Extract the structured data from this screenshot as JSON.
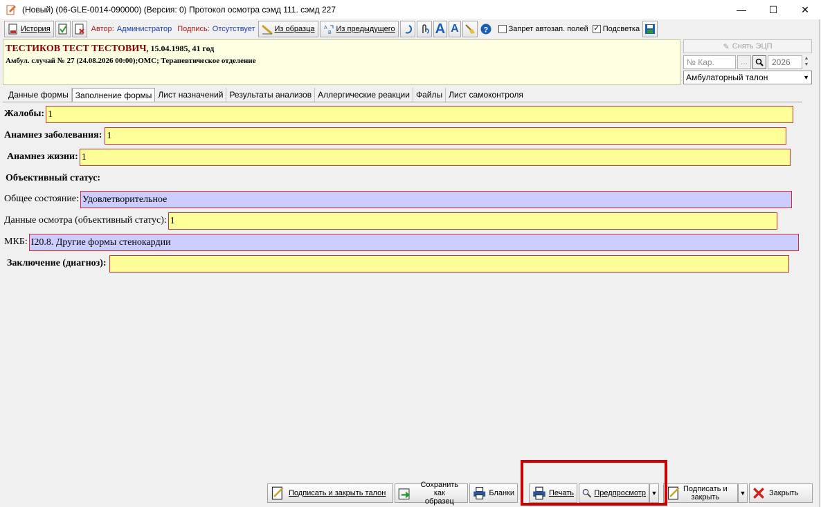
{
  "window": {
    "title": "(Новый) (06-GLE-0014-090000) (Версия: 0) Протокол осмотра  сэмд 111. сэмд 227"
  },
  "toolbar": {
    "history_label": "История",
    "author_label": "Автор:",
    "author_value": "Администратор",
    "sign_label": "Подпись:",
    "sign_value": "Отсутствует",
    "from_template_label": "Из образца",
    "from_previous_label": "Из предыдущего",
    "no_autofill_label": "Запрет автозап. полей",
    "no_autofill_checked": false,
    "highlight_label": "Подсветка",
    "highlight_checked": true
  },
  "patient": {
    "name": "ТЕСТИКОВ ТЕСТ ТЕСТОВИЧ",
    "dob_age": ", 15.04.1985, 41 год",
    "case": "Амбул. случай  № 27 (24.08.2026 00:00);ОМС; Терапевтическое отделение"
  },
  "right_panel": {
    "remove_ecp_label": "Снять ЭЦП",
    "card_placeholder": "№ Кар.",
    "dots_label": "...",
    "year": "2026",
    "talon_type": "Амбулаторный талон"
  },
  "tabs": [
    {
      "label": "Данные формы",
      "active": false
    },
    {
      "label": "Заполнение формы",
      "active": true
    },
    {
      "label": "Лист назначений",
      "active": false
    },
    {
      "label": "Результаты анализов",
      "active": false
    },
    {
      "label": "Аллергические реакции",
      "active": false
    },
    {
      "label": "Файлы",
      "active": false
    },
    {
      "label": "Лист самоконтроля",
      "active": false
    }
  ],
  "form": {
    "complaints_label": "Жалобы:",
    "complaints_value": "1",
    "anamnesis_disease_label": "Анамнез заболевания:",
    "anamnesis_disease_value": "1",
    "anamnesis_life_label": "Анамнез жизни:",
    "anamnesis_life_value": "1",
    "objective_status_label": "Объективный статус:",
    "general_state_label": "Общее состояние:",
    "general_state_value": "Удовлетворительное",
    "exam_data_label": "Данные осмотра (объективный статус):",
    "exam_data_value": "1",
    "mkb_label": "МКБ:",
    "mkb_value": "I20.8. Другие формы стенокардии",
    "conclusion_label": "Заключение (диагноз):",
    "conclusion_value": ""
  },
  "bottom_buttons": {
    "sign_close_talon": "Подписать и закрыть талон",
    "save_as_template_1": "Сохранить как",
    "save_as_template_2": "образец",
    "blanks": "Бланки",
    "print": "Печать",
    "preview": "Предпросмотр",
    "sign_close_1": "Подписать и",
    "sign_close_2": "закрыть",
    "close": "Закрыть"
  },
  "colors": {
    "required_field": "#ffff99",
    "lookup_field": "#ccccff",
    "field_border": "#d03030",
    "patient_name": "#8b0000",
    "annotation_box": "#cc0000"
  }
}
